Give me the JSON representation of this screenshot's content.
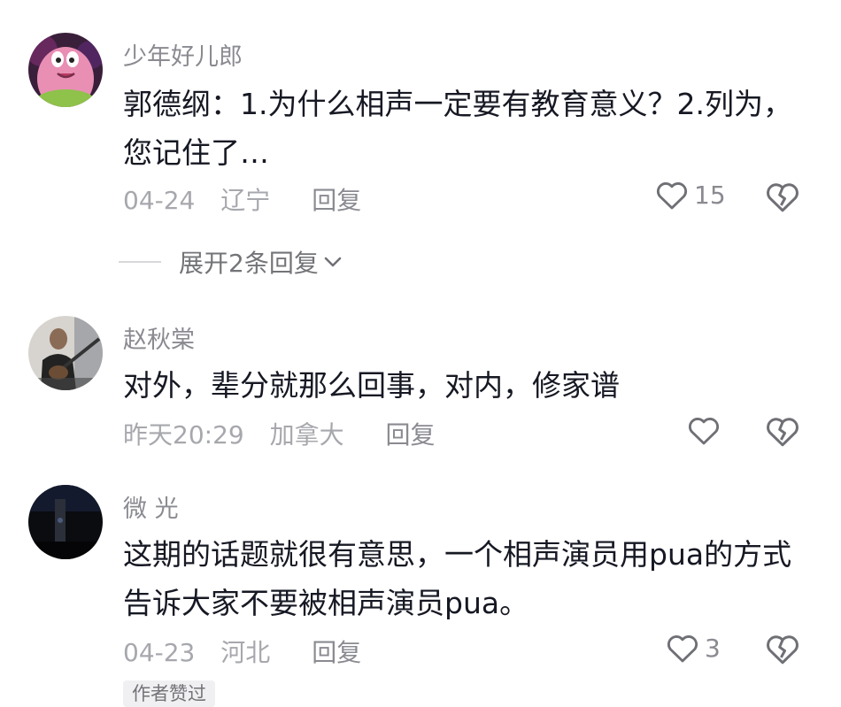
{
  "comments": [
    {
      "username": "少年好儿郎",
      "text": "郭德纲：1.为什么相声一定要有教育意义？2.列为，您记住了…",
      "date": "04-24",
      "location": "辽宁",
      "reply_label": "回复",
      "likes": "15",
      "avatar_icon": "patrick-star-avatar",
      "expand_label": "展开2条回复"
    },
    {
      "username": "赵秋棠",
      "text": "对外，辈分就那么回事，对内，修家谱",
      "date": "昨天20:29",
      "location": "加拿大",
      "reply_label": "回复",
      "likes": "",
      "avatar_icon": "guitar-player-avatar"
    },
    {
      "username": "微 光",
      "text": "这期的话题就很有意思，一个相声演员用pua的方式告诉大家不要被相声演员pua。",
      "date": "04-23",
      "location": "河北",
      "reply_label": "回复",
      "likes": "3",
      "avatar_icon": "night-sky-avatar",
      "author_badge": "作者赞过"
    }
  ]
}
